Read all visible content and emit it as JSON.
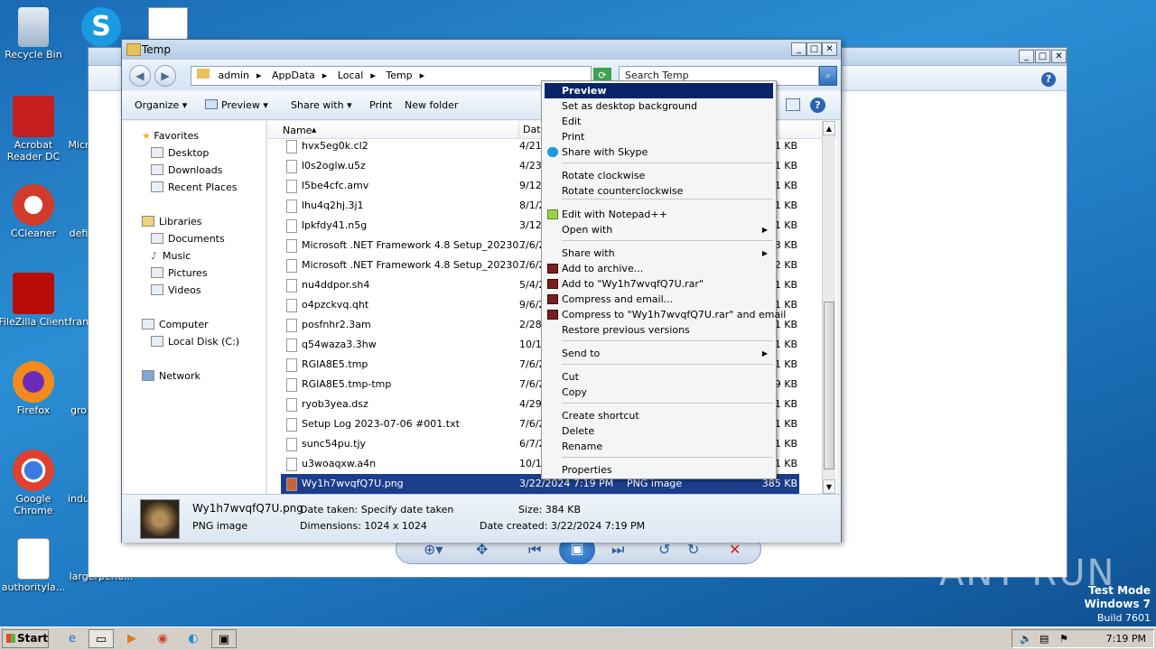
{
  "desktop": {
    "icons": [
      "Recycle Bin",
      "Acrobat Reader DC",
      "Micr",
      "CCleaner",
      "defi",
      "FileZilla Client",
      "fran",
      "Firefox",
      "gro",
      "Google Chrome",
      "indu",
      "authorityla...",
      "largerperio..."
    ]
  },
  "explorer": {
    "title": "Temp",
    "breadcrumb": [
      "admin",
      "AppData",
      "Local",
      "Temp"
    ],
    "search_placeholder": "Search Temp",
    "toolbar": [
      "Organize",
      "Preview",
      "Share with",
      "Print",
      "New folder"
    ],
    "nav": [
      "Favorites",
      "Desktop",
      "Downloads",
      "Recent Places",
      "Libraries",
      "Documents",
      "Music",
      "Pictures",
      "Videos",
      "Computer",
      "Local Disk (C:)",
      "Network"
    ],
    "columns": {
      "name": "Name",
      "date": "Date"
    },
    "files": [
      {
        "name": "hvx5eg0k.cl2",
        "date": "4/21/",
        "size": "1 KB"
      },
      {
        "name": "l0s2oglw.u5z",
        "date": "4/23/",
        "size": "1 KB"
      },
      {
        "name": "l5be4cfc.amv",
        "date": "9/12/",
        "size": "1 KB"
      },
      {
        "name": "lhu4q2hj.3j1",
        "date": "8/1/2",
        "size": "1 KB"
      },
      {
        "name": "lpkfdy41.n5g",
        "date": "3/12/",
        "size": "1 KB"
      },
      {
        "name": "Microsoft .NET Framework 4.8 Setup_20230...",
        "date": "7/6/2",
        "size": "3 KB"
      },
      {
        "name": "Microsoft .NET Framework 4.8 Setup_20230...",
        "date": "7/6/2",
        "size": "2 KB"
      },
      {
        "name": "nu4ddpor.sh4",
        "date": "5/4/2",
        "size": "1 KB"
      },
      {
        "name": "o4pzckvq.qht",
        "date": "9/6/2",
        "size": "1 KB"
      },
      {
        "name": "posfnhr2.3am",
        "date": "2/28/",
        "size": "1 KB"
      },
      {
        "name": "q54waza3.3hw",
        "date": "10/10",
        "size": "1 KB"
      },
      {
        "name": "RGIA8E5.tmp",
        "date": "7/6/2",
        "size": "1 KB"
      },
      {
        "name": "RGIA8E5.tmp-tmp",
        "date": "7/6/2",
        "size": "9 KB"
      },
      {
        "name": "ryob3yea.dsz",
        "date": "4/29/",
        "size": "1 KB"
      },
      {
        "name": "Setup Log 2023-07-06 #001.txt",
        "date": "7/6/2",
        "size": "1 KB"
      },
      {
        "name": "sunc54pu.tjy",
        "date": "6/7/2",
        "size": "1 KB"
      },
      {
        "name": "u3woaqxw.a4n",
        "date": "10/16",
        "size": "1 KB"
      }
    ],
    "selected": {
      "name": "Wy1h7wvqfQ7U.png",
      "date": "3/22/2024 7:19 PM",
      "type": "PNG image",
      "size": "385 KB"
    },
    "details": {
      "filename": "Wy1h7wvqfQ7U.png",
      "type": "PNG image",
      "date_taken": "Date taken: Specify date taken",
      "dimensions": "Dimensions: 1024 x 1024",
      "size": "Size: 384 KB",
      "date_created": "Date created: 3/22/2024 7:19 PM"
    }
  },
  "context_menu": [
    "Preview",
    "Set as desktop background",
    "Edit",
    "Print",
    "Share with Skype",
    "Rotate clockwise",
    "Rotate counterclockwise",
    "Edit with Notepad++",
    "Open with",
    "Share with",
    "Add to archive...",
    "Add to \"Wy1h7wvqfQ7U.rar\"",
    "Compress and email...",
    "Compress to \"Wy1h7wvqfQ7U.rar\" and email",
    "Restore previous versions",
    "Send to",
    "Cut",
    "Copy",
    "Create shortcut",
    "Delete",
    "Rename",
    "Properties"
  ],
  "taskbar": {
    "start": "Start",
    "clock": "7:19 PM"
  },
  "watermark": {
    "brand": "ANY RUN",
    "mode": "Test Mode",
    "os": "Windows 7",
    "build": "Build 7601"
  }
}
